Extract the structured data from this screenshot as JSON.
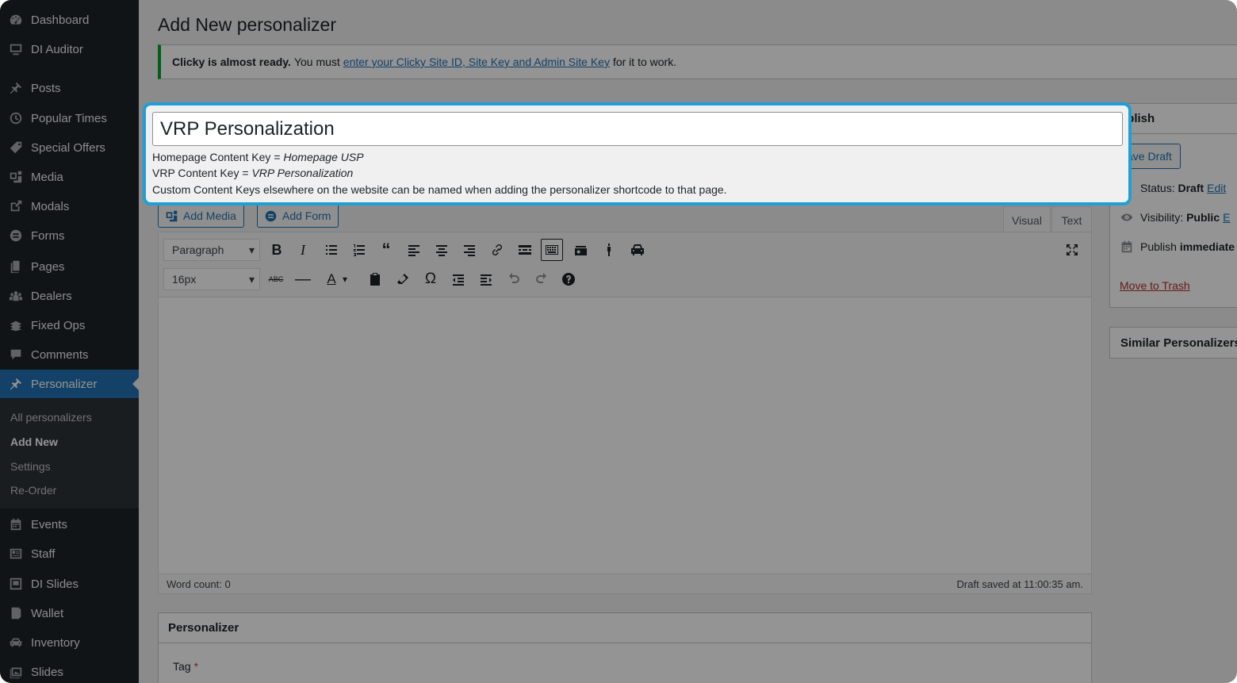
{
  "sidebar": {
    "items": [
      {
        "label": "Dashboard",
        "icon": "dashboard-icon"
      },
      {
        "label": "DI Auditor",
        "icon": "monitor-icon"
      },
      {
        "label": "Posts",
        "icon": "pin-icon"
      },
      {
        "label": "Popular Times",
        "icon": "clock-icon"
      },
      {
        "label": "Special Offers",
        "icon": "tag-icon"
      },
      {
        "label": "Media",
        "icon": "media-icon"
      },
      {
        "label": "Modals",
        "icon": "external-link-icon"
      },
      {
        "label": "Forms",
        "icon": "forms-icon"
      },
      {
        "label": "Pages",
        "icon": "pages-icon"
      },
      {
        "label": "Dealers",
        "icon": "groups-icon"
      },
      {
        "label": "Fixed Ops",
        "icon": "stack-icon"
      },
      {
        "label": "Comments",
        "icon": "comment-icon"
      },
      {
        "label": "Personalizer",
        "icon": "pin-icon"
      },
      {
        "label": "Events",
        "icon": "calendar-icon"
      },
      {
        "label": "Staff",
        "icon": "id-card-icon"
      },
      {
        "label": "DI Slides",
        "icon": "slides-icon"
      },
      {
        "label": "Wallet",
        "icon": "wallet-icon"
      },
      {
        "label": "Inventory",
        "icon": "car-icon"
      },
      {
        "label": "Slides",
        "icon": "gallery-icon"
      }
    ],
    "submenu": [
      "All personalizers",
      "Add New",
      "Settings",
      "Re-Order"
    ]
  },
  "page": {
    "title": "Add New personalizer"
  },
  "notice": {
    "strong": "Clicky is almost ready.",
    "pre": "You must",
    "link": "enter your Clicky Site ID, Site Key and Admin Site Key",
    "post": "for it to work."
  },
  "title_box": {
    "value": "VRP Personalization",
    "hint1_prefix": "Homepage Content Key =",
    "hint1_value": "Homepage USP",
    "hint2_prefix": "VRP Content Key =",
    "hint2_value": "VRP Personalization",
    "hint3": "Custom Content Keys elsewhere on the website can be named when adding the personalizer shortcode to that page."
  },
  "editor": {
    "add_media": "Add Media",
    "add_form": "Add Form",
    "tab_visual": "Visual",
    "tab_text": "Text",
    "format_select": "Paragraph",
    "size_select": "16px",
    "word_count": "Word count: 0",
    "draft_saved": "Draft saved at 11:00:35 am."
  },
  "personalizer_box": {
    "title": "Personalizer",
    "tag_label": "Tag",
    "required_mark": "*"
  },
  "publish": {
    "title": "ublish",
    "save_draft": "ave Draft",
    "status_label": "Status:",
    "status_value": "Draft",
    "status_edit": "Edit",
    "visibility_label": "Visibility:",
    "visibility_value": "Public",
    "visibility_edit": "E",
    "publish_label": "Publish",
    "publish_value": "immediate",
    "move_to_trash": "Move to Trash"
  },
  "similar": {
    "title": "Similar Personalizers"
  },
  "colors": {
    "sidebar_bg": "#1d2327",
    "active_blue": "#2271b1",
    "highlight_border": "#1ea0d6",
    "notice_green": "#00a32a"
  }
}
